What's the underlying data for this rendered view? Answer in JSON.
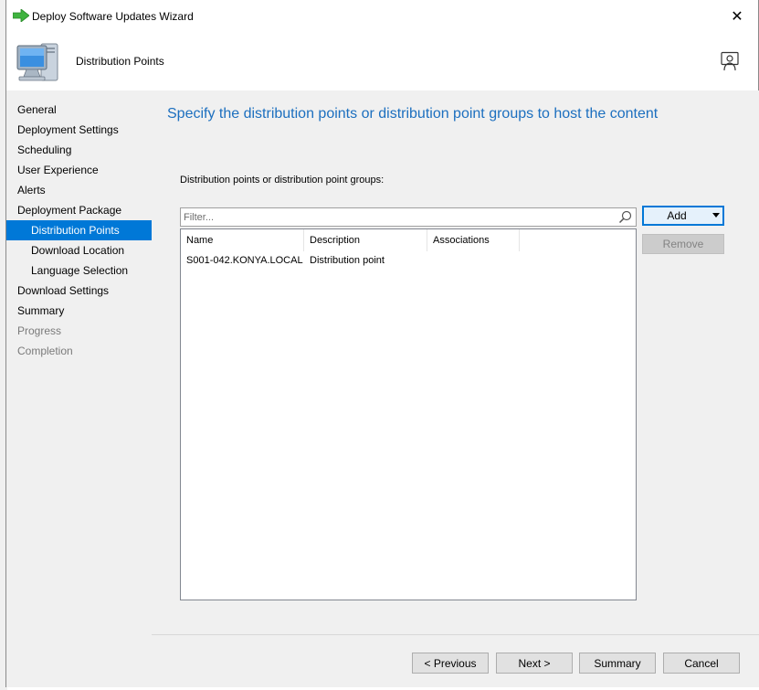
{
  "window": {
    "title": "Deploy Software Updates Wizard",
    "close_symbol": "✕"
  },
  "header": {
    "page_title": "Distribution Points"
  },
  "nav": {
    "items": [
      {
        "label": "General",
        "level": 1,
        "state": "normal"
      },
      {
        "label": "Deployment Settings",
        "level": 1,
        "state": "normal"
      },
      {
        "label": "Scheduling",
        "level": 1,
        "state": "normal"
      },
      {
        "label": "User Experience",
        "level": 1,
        "state": "normal"
      },
      {
        "label": "Alerts",
        "level": 1,
        "state": "normal"
      },
      {
        "label": "Deployment Package",
        "level": 1,
        "state": "normal"
      },
      {
        "label": "Distribution Points",
        "level": 2,
        "state": "active"
      },
      {
        "label": "Download Location",
        "level": 2,
        "state": "normal"
      },
      {
        "label": "Language Selection",
        "level": 2,
        "state": "normal"
      },
      {
        "label": "Download Settings",
        "level": 1,
        "state": "normal"
      },
      {
        "label": "Summary",
        "level": 1,
        "state": "normal"
      },
      {
        "label": "Progress",
        "level": 1,
        "state": "disabled"
      },
      {
        "label": "Completion",
        "level": 1,
        "state": "disabled"
      }
    ]
  },
  "main": {
    "heading": "Specify the distribution points or distribution point groups to host the content",
    "list_label": "Distribution points or distribution point groups:",
    "filter_placeholder": "Filter...",
    "columns": [
      "Name",
      "Description",
      "Associations"
    ],
    "rows": [
      {
        "name": "S001-042.KONYA.LOCAL",
        "description": "Distribution point",
        "associations": ""
      }
    ],
    "add_label": "Add",
    "remove_label": "Remove"
  },
  "footer": {
    "previous_label": "< Previous",
    "next_label": "Next >",
    "summary_label": "Summary",
    "cancel_label": "Cancel"
  },
  "colors": {
    "accent": "#0078d7",
    "heading": "#1c6fbf",
    "panel_bg": "#f0f0f0"
  }
}
